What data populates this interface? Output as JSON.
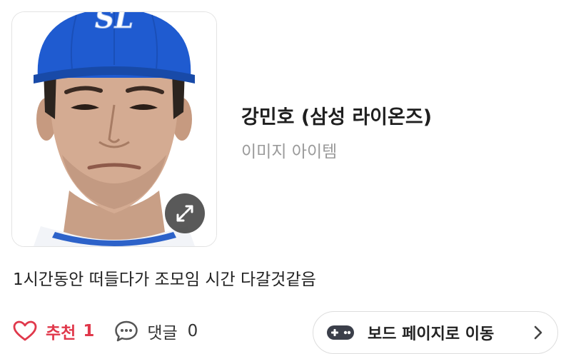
{
  "item": {
    "title": "강민호 (삼성 라이온즈)",
    "subtitle": "이미지 아이템",
    "cap_logo_text": "SL"
  },
  "post": {
    "text": "1시간동안 떠들다가 조모임 시간 다갈것같음"
  },
  "actions": {
    "like_label": "추천",
    "like_count": "1",
    "comment_label": "댓글",
    "comment_count": "0",
    "board_button_label": "보드 페이지로 이동"
  },
  "colors": {
    "like": "#e0384b",
    "cap_blue": "#1f5bd0",
    "subtitle_gray": "#9a9a9a"
  },
  "icons": {
    "expand": "expand-arrows-icon",
    "like": "heart-icon",
    "comment": "speech-bubble-icon",
    "board": "gamepad-icon",
    "chevron": "chevron-right-icon"
  }
}
